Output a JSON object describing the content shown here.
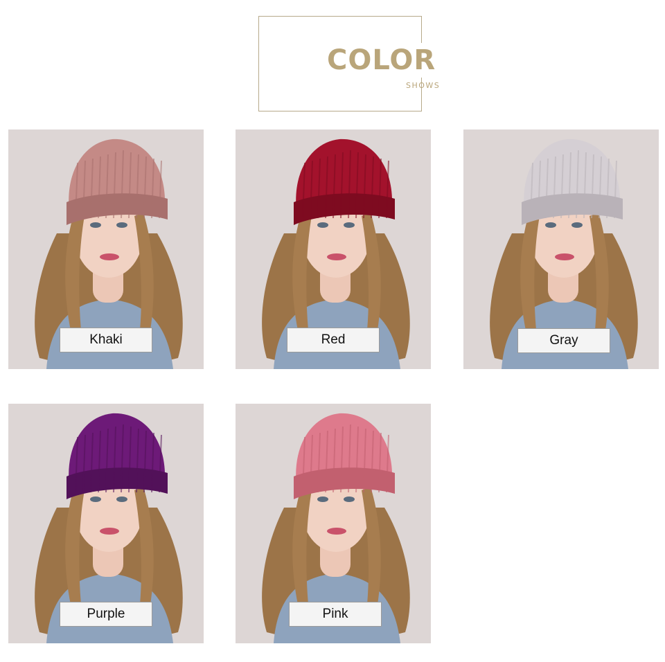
{
  "header": {
    "title": "COLOR",
    "subtitle": "SHOWS",
    "accent_color": "#b9a57a"
  },
  "products": [
    {
      "label": "Khaki",
      "hat_color": "#c48a86",
      "hat_shade": "#a8706d"
    },
    {
      "label": "Red",
      "hat_color": "#a3122c",
      "hat_shade": "#7e0b20"
    },
    {
      "label": "Gray",
      "hat_color": "#d5cfd4",
      "hat_shade": "#b9b2b8"
    },
    {
      "label": "Purple",
      "hat_color": "#6d1a78",
      "hat_shade": "#521159"
    },
    {
      "label": "Pink",
      "hat_color": "#de7a8c",
      "hat_shade": "#c2606f"
    }
  ]
}
